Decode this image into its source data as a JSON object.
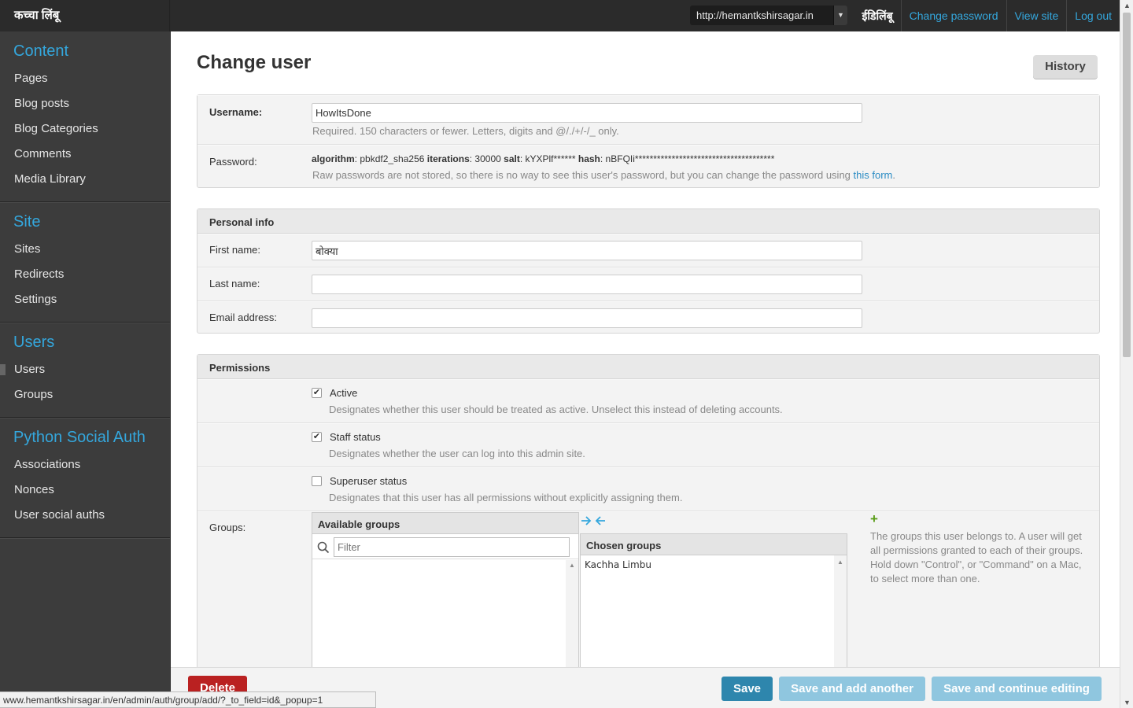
{
  "sidebar": {
    "brand": "कच्चा लिंबू",
    "sections": [
      {
        "title": "Content",
        "items": [
          "Pages",
          "Blog posts",
          "Blog Categories",
          "Comments",
          "Media Library"
        ]
      },
      {
        "title": "Site",
        "items": [
          "Sites",
          "Redirects",
          "Settings"
        ]
      },
      {
        "title": "Users",
        "items": [
          "Users",
          "Groups"
        ]
      },
      {
        "title": "Python Social Auth",
        "items": [
          "Associations",
          "Nonces",
          "User social auths"
        ]
      }
    ]
  },
  "topbar": {
    "site_select": "http://hemantkshirsagar.in",
    "username": "ईडिलिंबू",
    "change_password": "Change password",
    "view_site": "View site",
    "log_out": "Log out"
  },
  "page": {
    "title": "Change user",
    "history": "History"
  },
  "account": {
    "username_label": "Username:",
    "username_value": "HowItsDone",
    "username_help": "Required. 150 characters or fewer. Letters, digits and @/./+/-/_ only.",
    "password_label": "Password:",
    "pw_algorithm_key": "algorithm",
    "pw_algorithm_val": ": pbkdf2_sha256 ",
    "pw_iterations_key": "iterations",
    "pw_iterations_val": ": 30000 ",
    "pw_salt_key": "salt",
    "pw_salt_val": ": kYXPlf****** ",
    "pw_hash_key": "hash",
    "pw_hash_val": ": nBFQIi**************************************",
    "password_help": "Raw passwords are not stored, so there is no way to see this user's password, but you can change the password using ",
    "password_link": "this form",
    "password_help_end": "."
  },
  "personal": {
    "heading": "Personal info",
    "first_name_label": "First name:",
    "first_name_value": "बोक्या",
    "last_name_label": "Last name:",
    "last_name_value": "",
    "email_label": "Email address:",
    "email_value": ""
  },
  "permissions": {
    "heading": "Permissions",
    "active_label": "Active",
    "active_checked": true,
    "active_help": "Designates whether this user should be treated as active. Unselect this instead of deleting accounts.",
    "staff_label": "Staff status",
    "staff_checked": true,
    "staff_help": "Designates whether the user can log into this admin site.",
    "superuser_label": "Superuser status",
    "superuser_checked": false,
    "superuser_help": "Designates that this user has all permissions without explicitly assigning them.",
    "groups_label": "Groups:",
    "available_heading": "Available groups",
    "filter_placeholder": "Filter",
    "chosen_heading": "Chosen groups",
    "chosen_items": [
      "Kachha Limbu"
    ],
    "groups_help": "The groups this user belongs to. A user will get all permissions granted to each of their groups. Hold down \"Control\", or \"Command\" on a Mac, to select more than one."
  },
  "footer": {
    "delete": "Delete",
    "save": "Save",
    "save_add": "Save and add another",
    "save_continue": "Save and continue editing"
  },
  "statusbar": "www.hemantkshirsagar.in/en/admin/auth/group/add/?_to_field=id&_popup=1",
  "colors": {
    "sidebar_bg": "#3c3c3c",
    "accent": "#34a7dd",
    "save_button": "#2e86ad",
    "delete_button": "#ba2121",
    "disabled_button": "#8fc6df"
  }
}
